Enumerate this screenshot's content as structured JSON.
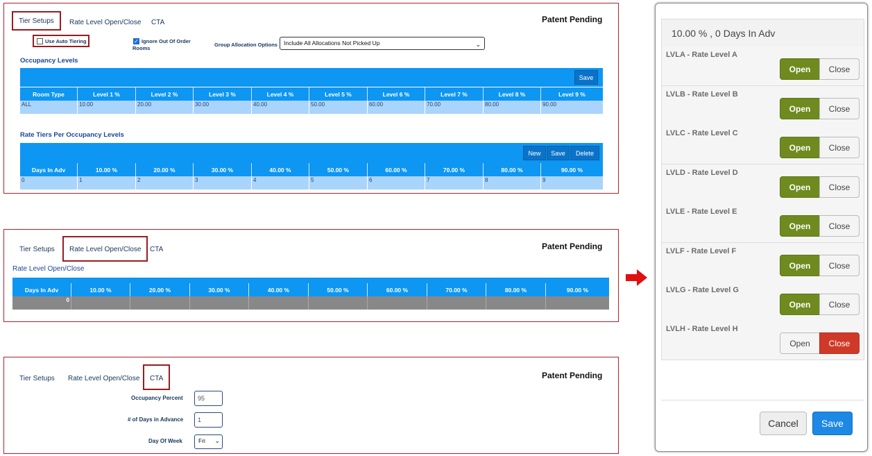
{
  "patent": "Patent Pending",
  "tabs": {
    "tier": "Tier Setups",
    "rate": "Rate Level Open/Close",
    "cta": "CTA"
  },
  "panel1": {
    "auto_tiering": "Use Auto Tiering",
    "ignore_out_of_order": "Ignore Out Of Order Rooms",
    "ignore_checked": true,
    "group_alloc_label": "Group Allocation Options",
    "group_alloc_value": "Include All Allocations Not Picked Up",
    "occupancy_title": "Occupancy Levels",
    "save": "Save",
    "occ_headers": [
      "Room Type",
      "Level 1 %",
      "Level 2 %",
      "Level 3 %",
      "Level 4 %",
      "Level 5 %",
      "Level 6 %",
      "Level 7 %",
      "Level 8 %",
      "Level 9 %"
    ],
    "occ_row": [
      "ALL",
      "10.00",
      "20.00",
      "30.00",
      "40.00",
      "50.00",
      "60.00",
      "70.00",
      "80.00",
      "90.00"
    ],
    "tiers_title": "Rate Tiers Per Occupancy Levels",
    "new": "New",
    "delete": "Delete",
    "tier_headers": [
      "Days In Adv",
      "10.00 %",
      "20.00 %",
      "30.00 %",
      "40.00 %",
      "50.00 %",
      "60.00 %",
      "70.00 %",
      "80.00 %",
      "90.00 %"
    ],
    "tier_row": [
      "0",
      "1",
      "2",
      "3",
      "4",
      "5",
      "6",
      "7",
      "8",
      "9"
    ]
  },
  "panel2": {
    "title": "Rate Level Open/Close",
    "headers": [
      "Days In Adv",
      "10.00 %",
      "20.00 %",
      "30.00 %",
      "40.00 %",
      "50.00 %",
      "60.00 %",
      "70.00 %",
      "80.00 %",
      "90.00 %"
    ],
    "row_value": "0"
  },
  "panel3": {
    "occ_label": "Occupancy Percent",
    "occ_value": "95",
    "days_label": "# of Days in Advance",
    "days_value": "1",
    "dow_label": "Day Of Week",
    "dow_value": "Fri"
  },
  "modal": {
    "title": "10.00 % , 0 Days In Adv",
    "levels": [
      {
        "name": "LVLA - Rate Level A",
        "state": "open"
      },
      {
        "name": "LVLB - Rate Level B",
        "state": "open"
      },
      {
        "name": "LVLC - Rate Level C",
        "state": "open"
      },
      {
        "name": "LVLD - Rate Level D",
        "state": "open"
      },
      {
        "name": "LVLE - Rate Level E",
        "state": "open"
      },
      {
        "name": "LVLF - Rate Level F",
        "state": "open"
      },
      {
        "name": "LVLG - Rate Level G",
        "state": "open"
      },
      {
        "name": "LVLH - Rate Level H",
        "state": "close"
      }
    ],
    "open_label": "Open",
    "close_label": "Close",
    "cancel": "Cancel",
    "save": "Save"
  },
  "colors": {
    "accent_blue": "#0d96f2",
    "panel_border": "#b3202a",
    "open_green": "#6f8a1e",
    "close_red": "#cf3a28",
    "arrow_red": "#e01010"
  }
}
